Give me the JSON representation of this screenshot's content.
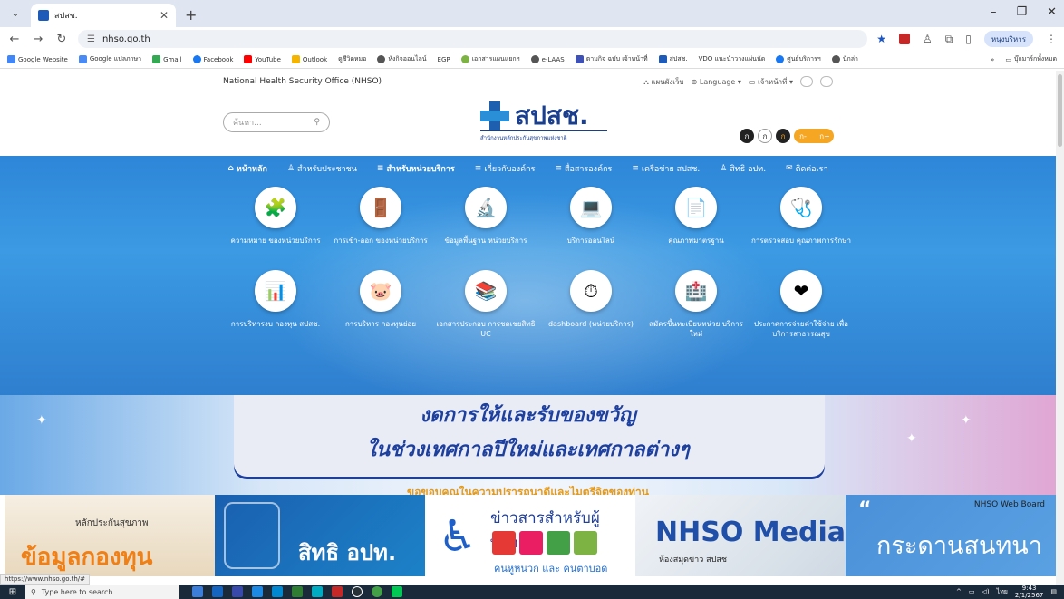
{
  "browser": {
    "tab_title": "สปสช.",
    "url": "nhso.go.th",
    "profile_label": "หนุงบริหาร",
    "bookmarks": [
      "Google Website",
      "Google แปลภาษา",
      "Gmail",
      "Facebook",
      "YouTube",
      "Outlook",
      "ดูชีวิตหมอ",
      "หังกิจออนไลน์",
      "EGP",
      "เอกสารแผนแยกฯ",
      "e-LAAS",
      "ตามกิจ ฉบับ เจ้าหน้าที่",
      "สปสช.",
      "VDO แนะนำวางแผ่นนัด",
      "ศูนย์บริการฯ",
      "นักล่า"
    ],
    "bookmark_folder": "บุ๊กมาร์กทั้งหมด",
    "status_url": "https://www.nhso.go.th/#"
  },
  "site": {
    "org_en": "National Health Security Office (NHSO)",
    "sitemap": "แผนผังเว็บ",
    "language": "Language",
    "staff": "เจ้าหน้าที่",
    "search_placeholder": "ค้นหา...",
    "logo_text": "สปสช.",
    "logo_sub": "สำนักงานหลักประกันสุขภาพแห่งชาติ",
    "font_controls": [
      "ก",
      "ก",
      "ก",
      "ก-",
      "ก+"
    ]
  },
  "menu": [
    {
      "label": "หน้าหลัก",
      "icon": "home-icon"
    },
    {
      "label": "สำหรับประชาชน",
      "icon": "people-icon"
    },
    {
      "label": "สำหรับหน่วยบริการ",
      "icon": "list-icon"
    },
    {
      "label": "เกี่ยวกับองค์กร",
      "icon": "list-icon"
    },
    {
      "label": "สื่อสารองค์กร",
      "icon": "list-icon"
    },
    {
      "label": "เครือข่าย สปสช.",
      "icon": "list-icon"
    },
    {
      "label": "สิทธิ อปท.",
      "icon": "people-icon"
    },
    {
      "label": "ติดต่อเรา",
      "icon": "mail-icon"
    }
  ],
  "services": [
    {
      "label": "ความหมาย ของหน่วยบริการ",
      "icon": "puzzle-icon",
      "glyph": "🧩"
    },
    {
      "label": "การเข้า-ออก ของหน่วยบริการ",
      "icon": "door-icon",
      "glyph": "🚪"
    },
    {
      "label": "ข้อมูลพื้นฐาน หน่วยบริการ",
      "icon": "microscope-icon",
      "glyph": "🔬"
    },
    {
      "label": "บริการออนไลน์",
      "icon": "laptop-icon",
      "glyph": "💻"
    },
    {
      "label": "คุณภาพมาตรฐาน",
      "icon": "document-icon",
      "glyph": "📄"
    },
    {
      "label": "การตรวจสอบ คุณภาพการรักษา",
      "icon": "doctor-icon",
      "glyph": "🩺"
    },
    {
      "label": "การบริหารงบ กองทุน สปสช.",
      "icon": "chart-icon",
      "glyph": "📊"
    },
    {
      "label": "การบริหาร กองทุนย่อย",
      "icon": "piggybank-icon",
      "glyph": "🐷"
    },
    {
      "label": "เอกสารประกอบ การชดเชยสิทธิ UC",
      "icon": "books-icon",
      "glyph": "📚"
    },
    {
      "label": "dashboard (หน่วยบริการ)",
      "icon": "gauge-icon",
      "glyph": "⏱"
    },
    {
      "label": "สมัครขึ้นทะเบียนหน่วย บริการใหม่",
      "icon": "hospital-icon",
      "glyph": "🏥"
    },
    {
      "label": "ประกาศการจ่ายค่าใช้จ่าย เพื่อบริการสาธารณสุข",
      "icon": "heart-icon",
      "glyph": "❤"
    }
  ],
  "banner": {
    "line1": "งดการให้และรับของขวัญ",
    "line2": "ในช่วงเทศกาลปีใหม่และเทศกาลต่างๆ",
    "line3": "ขอขอบคุณในความปรารถนาดีและไมตรีจิตของท่าน"
  },
  "tiles": {
    "fund_small": "หลักประกันสุขภาพ",
    "fund_big": "ข้อมูลกองทุน",
    "rights_big": "สิทธิ อปท.",
    "disabled_title": "ข่าวสารสำหรับผู้พิการ",
    "disabled_sub": "คนหูหนวก และ คนตาบอด",
    "media_big": "NHSO Media",
    "media_small": "ห้องสมุดข่าว สปสช",
    "board_tag": "NHSO Web Board",
    "board_big": "กระดานสนทนา"
  },
  "taskbar": {
    "search_placeholder": "Type here to search",
    "time": "9:43",
    "date": "2/1/2567",
    "lang": "ไทย"
  }
}
